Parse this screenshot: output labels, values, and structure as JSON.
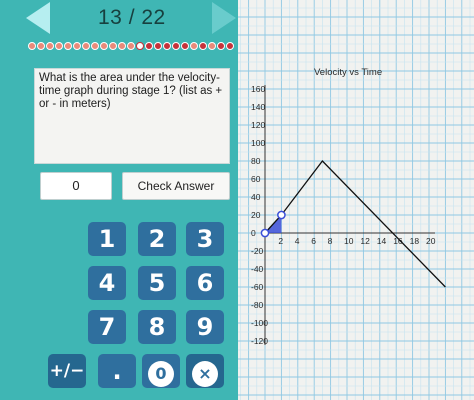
{
  "nav": {
    "progress": "13 / 22"
  },
  "progress_dots": [
    "done",
    "done",
    "done",
    "done",
    "done",
    "done",
    "done",
    "done",
    "done",
    "done",
    "done",
    "done",
    "current",
    "wrong",
    "wrong",
    "wrong",
    "wrong",
    "wrong",
    "done",
    "wrong",
    "done",
    "wrong",
    "wrong"
  ],
  "question": {
    "text": "What is the area under the velocity-time graph during stage 1? (list as + or - in meters)"
  },
  "answer": {
    "value": "0"
  },
  "check_button": {
    "label": "Check Answer"
  },
  "keypad": {
    "rows": [
      [
        "1",
        "2",
        "3"
      ],
      [
        "4",
        "5",
        "6"
      ],
      [
        "7",
        "8",
        "9"
      ]
    ],
    "sign_key": "+/−",
    "decimal_key": ".",
    "zero_key": "0",
    "clear_icon": "×"
  },
  "colors": {
    "panel": "#3fb6b4",
    "key": "#2f6f9e",
    "graph_line": "#111111",
    "stage1_fill": "#3b4fd8"
  },
  "chart_data": {
    "type": "line",
    "title": "Velocity vs Time",
    "xlabel": "",
    "ylabel": "",
    "xlim": [
      0,
      20
    ],
    "ylim": [
      -120,
      160
    ],
    "x_ticks": [
      2,
      4,
      6,
      8,
      10,
      12,
      14,
      16,
      18,
      20
    ],
    "y_ticks": [
      160,
      140,
      120,
      100,
      80,
      60,
      40,
      20,
      0,
      -20,
      -40,
      -60,
      -80,
      -100,
      -120
    ],
    "grid": true,
    "series": [
      {
        "x": [
          0,
          2,
          7,
          22
        ],
        "y": [
          0,
          20,
          80,
          -60
        ]
      }
    ],
    "shaded_region": {
      "label": "stage 1",
      "x": [
        0,
        2
      ],
      "y": [
        0,
        20
      ]
    }
  }
}
